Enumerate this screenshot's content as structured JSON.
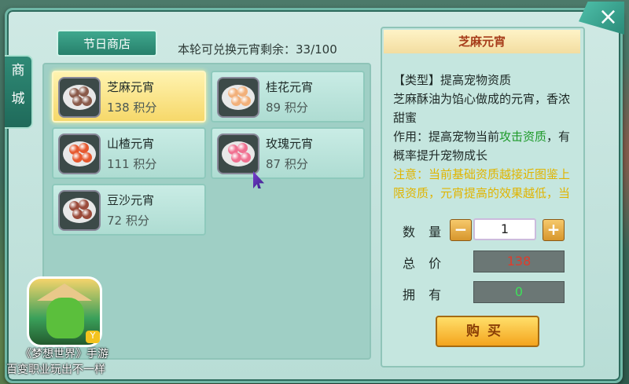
{
  "side_tab": "商城",
  "close_label": "×",
  "shop_tab": "节日商店",
  "remaining": "本轮可兑换元宵剩余：33/100",
  "items": [
    {
      "name": "芝麻元宵",
      "price": "138 积分",
      "ball_color": "#8a5a4a",
      "selected": true
    },
    {
      "name": "桂花元宵",
      "price": "89 积分",
      "ball_color": "#f2b07a",
      "selected": false
    },
    {
      "name": "山楂元宵",
      "price": "111 积分",
      "ball_color": "#e6582e",
      "selected": false
    },
    {
      "name": "玫瑰元宵",
      "price": "87 积分",
      "ball_color": "#f07090",
      "selected": false
    },
    {
      "name": "豆沙元宵",
      "price": "72 积分",
      "ball_color": "#9a4a3a",
      "selected": false
    }
  ],
  "detail": {
    "title": "芝麻元宵",
    "line1": "【类型】提高宠物资质",
    "line2": "芝麻酥油为馅心做成的元宵，香浓甜蜜",
    "use_prefix": "作用：提高宠物当前",
    "use_highlight": "攻击资质",
    "use_suffix": "，有概率提升宠物成长",
    "note": "注意：当前基础资质越接近图鉴上限资质，元宵提高的效果越低，当前基础资质..."
  },
  "quantity_label": "数 量",
  "quantity_value": "1",
  "minus": "−",
  "plus": "+",
  "total_label": "总 价",
  "total_value": "138",
  "own_label": "拥 有",
  "own_value": "0",
  "buy_label": "购买",
  "promo": {
    "title": "《梦想世界》手游",
    "subtitle": "百变职业玩出不一样",
    "badge": "Y"
  },
  "colors": {
    "total": "#e23a2a",
    "own": "#3ee05a"
  }
}
